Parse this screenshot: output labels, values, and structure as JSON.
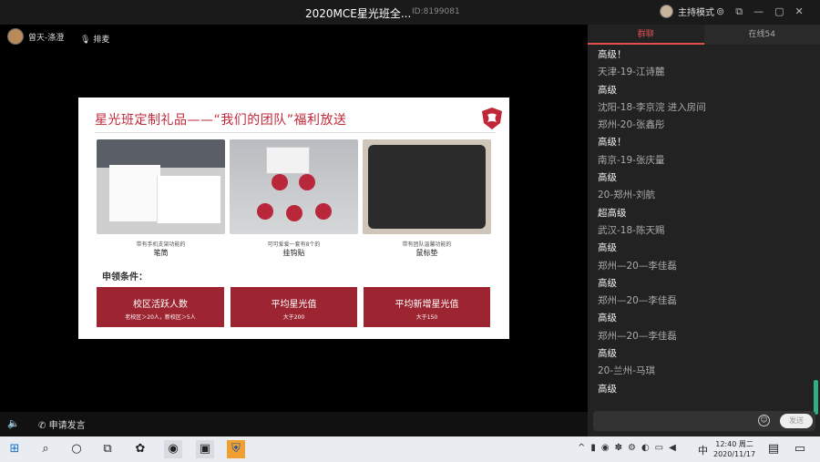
{
  "window": {
    "title": "2020MCE星光班全...",
    "room_id": "ID:8199081",
    "host_label": "主持模式"
  },
  "stage": {
    "user_name": "曾天-涤澄",
    "mic_label": "排麦"
  },
  "slide": {
    "title": "星光班定制礼品——“我们的团队”福利放送",
    "products": [
      {
        "caption": "带有手机支架功能的",
        "name": "笔筒"
      },
      {
        "caption": "可可爱爱一套有8个的",
        "name": "挂钩贴"
      },
      {
        "caption": "带有团队温馨功能的",
        "name": "鼠标垫"
      }
    ],
    "conditions_title": "申领条件：",
    "conditions": [
      {
        "label": "校区活跃人数",
        "sub": "老校区＞20人，新校区＞5人"
      },
      {
        "label": "平均星光值",
        "sub": "大于200"
      },
      {
        "label": "平均新增星光值",
        "sub": "大于150"
      }
    ],
    "brand_color": "#c0283a",
    "box_color": "#9c2531"
  },
  "bottombar": {
    "speak_label": "申请发言"
  },
  "side": {
    "tab_chat": "群聊",
    "tab_online": "在线54",
    "messages": [
      {
        "text": "高级！",
        "kind": "lvl"
      },
      {
        "text": "天津-19-江诗麓",
        "kind": "name"
      },
      {
        "text": "高级",
        "kind": "lvl"
      },
      {
        "text": "沈阳-18-李京浣 进入房间",
        "kind": "name"
      },
      {
        "text": "郑州-20-张鑫彤",
        "kind": "name"
      },
      {
        "text": "高级！",
        "kind": "lvl"
      },
      {
        "text": "南京-19-张庆量",
        "kind": "name"
      },
      {
        "text": "高级",
        "kind": "lvl"
      },
      {
        "text": "20-郑州-刘航",
        "kind": "name"
      },
      {
        "text": "超高级",
        "kind": "lvl"
      },
      {
        "text": "武汉-18-陈天赐",
        "kind": "name"
      },
      {
        "text": "高级",
        "kind": "lvl"
      },
      {
        "text": "郑州—20—李佳磊",
        "kind": "name"
      },
      {
        "text": "高级",
        "kind": "lvl"
      },
      {
        "text": "郑州—20—李佳磊",
        "kind": "name"
      },
      {
        "text": "高级",
        "kind": "lvl"
      },
      {
        "text": "郑州—20—李佳磊",
        "kind": "name"
      },
      {
        "text": "高级",
        "kind": "lvl"
      },
      {
        "text": "20-兰州-马琪",
        "kind": "name"
      },
      {
        "text": "高级",
        "kind": "lvl"
      }
    ],
    "send_label": "发送"
  },
  "taskbar": {
    "ime": "中",
    "time": "12:40 周二",
    "date": "2020/11/17"
  }
}
